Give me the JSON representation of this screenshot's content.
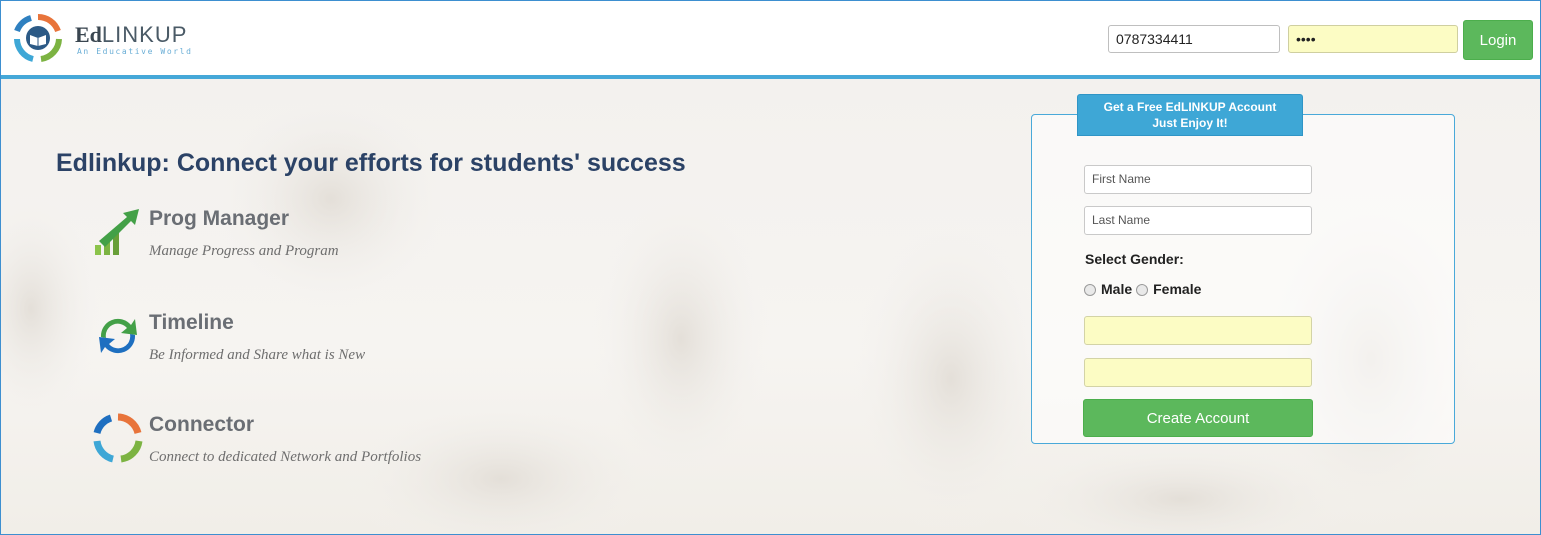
{
  "brand": {
    "name_prefix": "Ed",
    "name_suffix": "LINKUP",
    "tagline": "An Educative World"
  },
  "login": {
    "username_value": "0787334411",
    "password_mask": "••••",
    "button_label": "Login"
  },
  "hero": {
    "headline": "Edlinkup: Connect your efforts for students' success",
    "features": [
      {
        "title": "Prog Manager",
        "description": "Manage Progress and Program",
        "icon": "growth-chart-arrow-icon"
      },
      {
        "title": "Timeline",
        "description": "Be Informed and Share what is New",
        "icon": "refresh-cycle-icon"
      },
      {
        "title": "Connector",
        "description": "Connect to dedicated Network and Portfolios",
        "icon": "circular-arrows-icon"
      }
    ]
  },
  "signup": {
    "badge_line1": "Get a Free EdLINKUP Account",
    "badge_line2": "Just Enjoy It!",
    "first_name_placeholder": "First Name",
    "last_name_placeholder": "Last Name",
    "gender_label": "Select Gender:",
    "gender_options": [
      "Male",
      "Female"
    ],
    "button_label": "Create Account"
  },
  "colors": {
    "accent_blue": "#45a8d8",
    "button_green": "#5cb85c",
    "headline_navy": "#2b4266",
    "autofill_yellow": "#fcfcc4"
  }
}
